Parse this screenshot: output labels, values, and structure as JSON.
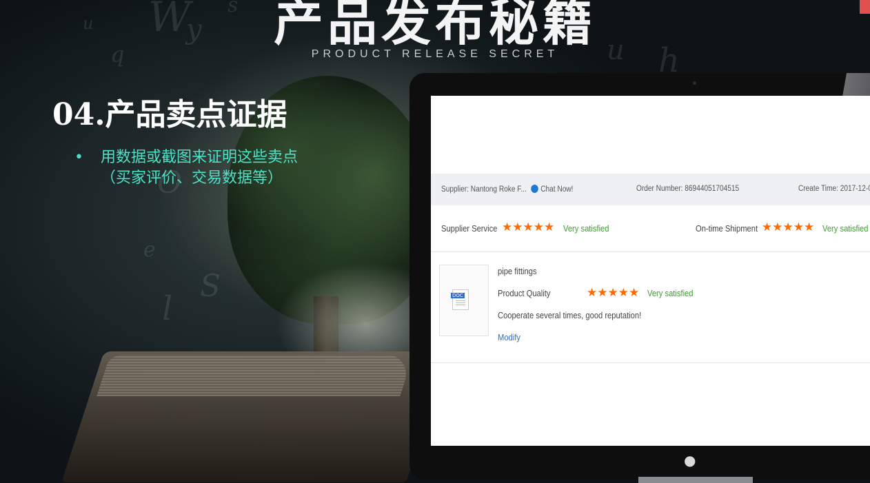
{
  "slide": {
    "title": "产品发布秘籍",
    "subtitle": "PRODUCT RELEASE SECRET",
    "section_title": "04.产品卖点证据",
    "bullet_marker": "•",
    "bullet_lines": [
      "用数据或截图来证明这些卖点",
      "（买家评价、交易数据等）"
    ]
  },
  "order": {
    "supplier_label": "Supplier:",
    "supplier_name": "Nantong Roke F...",
    "chat_label": "Chat Now!",
    "order_number_label": "Order Number:",
    "order_number": "86944051704515",
    "create_time_label": "Create Time:",
    "create_time": "2017-12-0"
  },
  "ratings": {
    "supplier_service_label": "Supplier Service",
    "supplier_service_stars": "★★★★★",
    "supplier_service_text": "Very satisfied",
    "shipment_label": "On-time Shipment",
    "shipment_stars": "★★★★★",
    "shipment_text": "Very satisfied"
  },
  "product": {
    "doc_tag": "DOC",
    "name": "pipe fittings",
    "quality_label": "Product Quality",
    "quality_stars": "★★★★★",
    "quality_text": "Very satisfied",
    "comment": "Cooperate several times, good reputation!",
    "modify_label": "Modify"
  },
  "icons": {
    "chat": "chat-bubble-icon",
    "document": "doc-file-icon",
    "apple": "apple-logo-icon"
  },
  "colors": {
    "accent_teal": "#4fe0c8",
    "star_orange": "#ff6a00",
    "satisfied_green": "#3aa02a",
    "link_blue": "#2f6ec1"
  }
}
